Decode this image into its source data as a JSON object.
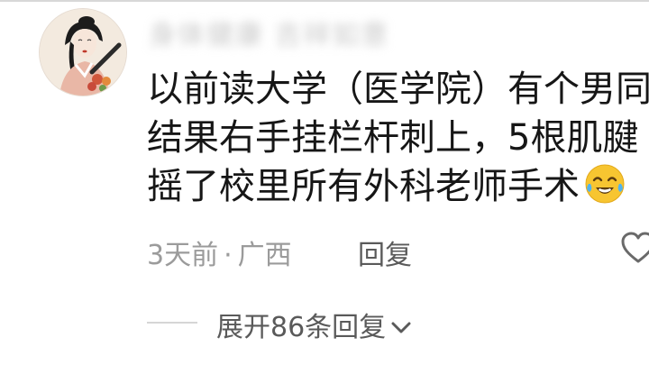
{
  "comment": {
    "username": "身体健康 吉祥如意",
    "lines": [
      "以前读大学（医学院）有个男同",
      "结果右手挂栏杆刺上，5根肌腱",
      "摇了校里所有外科老师手术"
    ],
    "emoji_name": "crying-laughing-emoji",
    "time": "3天前",
    "separator": "·",
    "location": "广西",
    "reply_label": "回复",
    "expand_label": "展开86条回复",
    "liked": false
  },
  "colors": {
    "text": "#161616",
    "meta": "#9b9b9b",
    "action": "#5a5a5a",
    "divider": "#d8d8d8"
  },
  "icons": [
    "heart-icon",
    "chevron-down-icon",
    "crying-laughing-emoji"
  ]
}
